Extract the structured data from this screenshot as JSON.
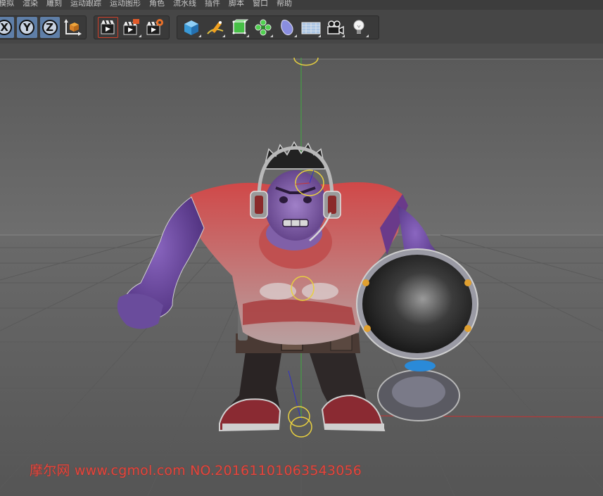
{
  "menu": {
    "items": [
      "模拟",
      "渲染",
      "雕刻",
      "运动跟踪",
      "运动图形",
      "角色",
      "流水线",
      "插件",
      "脚本",
      "窗口",
      "帮助"
    ]
  },
  "toolbar": {
    "axis_buttons": [
      "X",
      "Y",
      "Z"
    ],
    "icons": [
      "world-coordinates-icon",
      "render-view-icon",
      "render-to-picture-viewer-icon",
      "render-settings-icon",
      "cube-icon",
      "pen-spline-icon",
      "subdivision-icon",
      "cloner-icon",
      "deformer-icon",
      "floor-plane-icon",
      "camera-icon",
      "light-icon"
    ]
  },
  "viewport": {
    "watermark": "摩尔网 www.cgmol.com NO.20161101063543056"
  },
  "colors": {
    "background": "#505050",
    "axis_selected": "#5f7fa8",
    "axis_y": "#3faa3f",
    "axis_x": "#c83232",
    "axis_z": "#3232c8",
    "watermark": "#e0483f"
  }
}
